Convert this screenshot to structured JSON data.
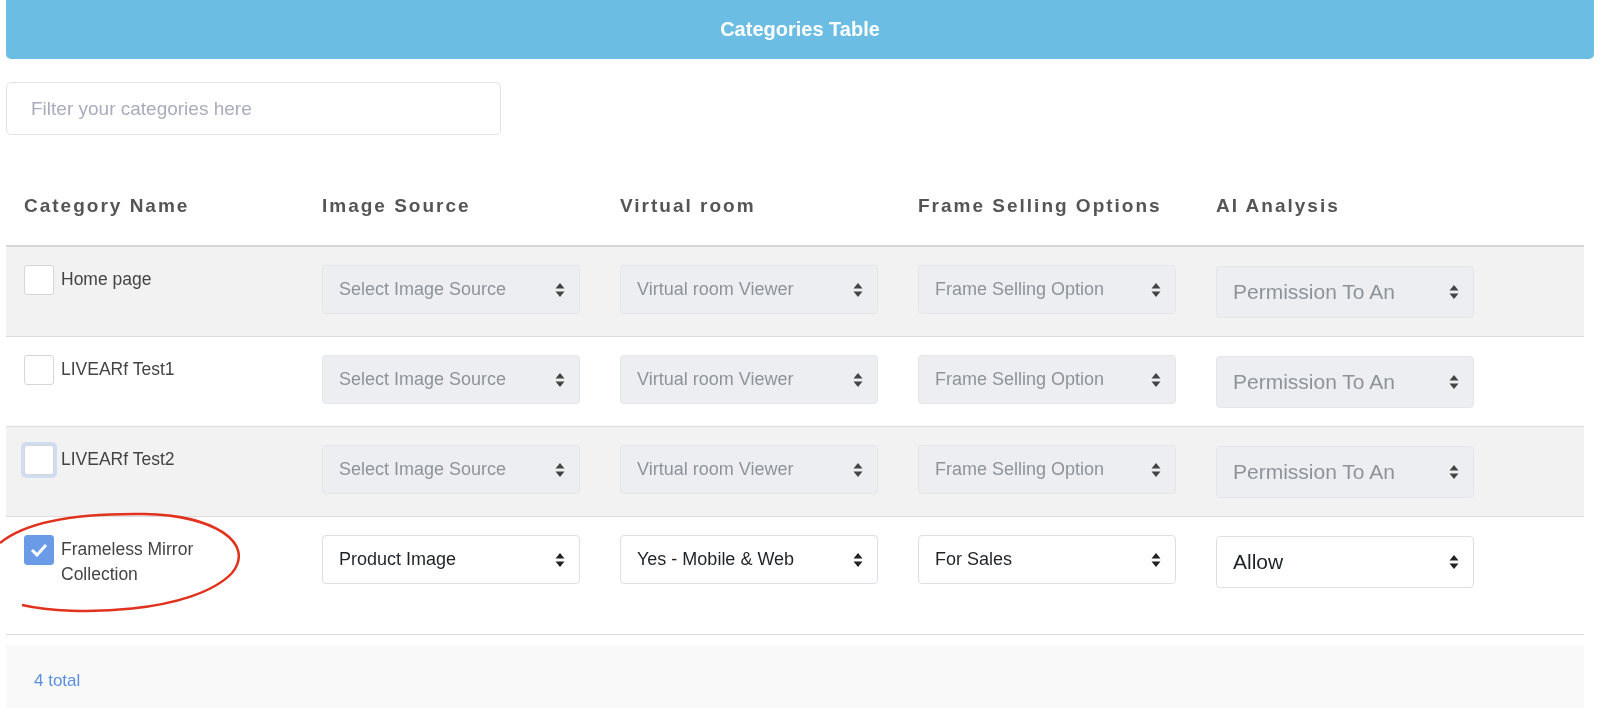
{
  "header": {
    "title": "Categories Table"
  },
  "filter": {
    "placeholder": "Filter your categories here"
  },
  "table": {
    "columns": [
      "Category Name",
      "Image Source",
      "Virtual room",
      "Frame Selling Options",
      "AI Analysis"
    ],
    "rows": [
      {
        "name": "Home page",
        "checked": false,
        "focused": false,
        "circled": false,
        "selects": [
          {
            "placeholder": "Select Image Source",
            "disabled": true
          },
          {
            "placeholder": "Virtual room Viewer",
            "disabled": true
          },
          {
            "placeholder": "Frame Selling Option",
            "disabled": true
          },
          {
            "placeholder": "Permission To An",
            "disabled": true
          }
        ]
      },
      {
        "name": "LIVEARf Test1",
        "checked": false,
        "focused": false,
        "circled": false,
        "selects": [
          {
            "placeholder": "Select Image Source",
            "disabled": true
          },
          {
            "placeholder": "Virtual room Viewer",
            "disabled": true
          },
          {
            "placeholder": "Frame Selling Option",
            "disabled": true
          },
          {
            "placeholder": "Permission To An",
            "disabled": true
          }
        ]
      },
      {
        "name": "LIVEARf Test2",
        "checked": false,
        "focused": true,
        "circled": false,
        "selects": [
          {
            "placeholder": "Select Image Source",
            "disabled": true
          },
          {
            "placeholder": "Virtual room Viewer",
            "disabled": true
          },
          {
            "placeholder": "Frame Selling Option",
            "disabled": true
          },
          {
            "placeholder": "Permission To An",
            "disabled": true
          }
        ]
      },
      {
        "name": "Frameless Mirror Collection",
        "checked": true,
        "focused": false,
        "circled": true,
        "selects": [
          {
            "value": "Product Image",
            "disabled": false
          },
          {
            "value": "Yes - Mobile & Web",
            "disabled": false
          },
          {
            "value": "For Sales",
            "disabled": false
          },
          {
            "value": "Allow",
            "disabled": false
          }
        ]
      }
    ]
  },
  "footer": {
    "total": "4 total"
  }
}
